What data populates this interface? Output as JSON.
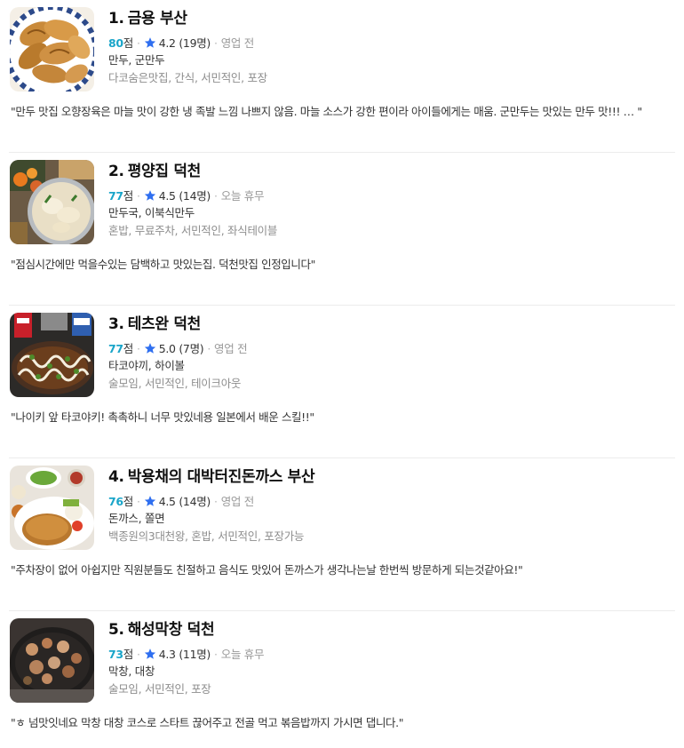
{
  "colors": {
    "score": "#1aa5c9",
    "star": "#2f6ff0",
    "muted": "#999999",
    "tags": "#8e8e8e"
  },
  "restaurants": [
    {
      "rank": "1.",
      "name": "금용 부산",
      "score": "80",
      "score_unit": "점",
      "rating": "4.2 (19명)",
      "status": "영업 전",
      "menu": "만두, 군만두",
      "tags": "다코숨은맛집, 간식, 서민적인, 포장",
      "review": "\"만두 맛집 오향장육은 마늘 맛이 강한 냉 족발 느낌 나쁘지 않음. 마늘 소스가 강한 편이라 아이들에게는 매움. 군만두는 맛있는 만두 맛!!! …   \"",
      "photo_icon": "dumpling-photo"
    },
    {
      "rank": "2.",
      "name": "평양집 덕천",
      "score": "77",
      "score_unit": "점",
      "rating": "4.5 (14명)",
      "status": "오늘 휴무",
      "menu": "만두국, 이북식만두",
      "tags": "혼밥, 무료주차, 서민적인, 좌식테이블",
      "review": "\"점심시간에만 먹을수있는 담백하고 맛있는집. 덕천맛집 인정입니다\"",
      "photo_icon": "dumpling-soup-photo"
    },
    {
      "rank": "3.",
      "name": "테츠완 덕천",
      "score": "77",
      "score_unit": "점",
      "rating": "5.0 (7명)",
      "status": "영업 전",
      "menu": "타코야끼, 하이볼",
      "tags": "술모임, 서민적인, 테이크아웃",
      "review": "\"나이키 앞 타코야키! 촉촉하니 너무 맛있네용 일본에서 배운 스킬!!\"",
      "photo_icon": "takoyaki-photo"
    },
    {
      "rank": "4.",
      "name": "박용채의 대박터진돈까스 부산",
      "score": "76",
      "score_unit": "점",
      "rating": "4.5 (14명)",
      "status": "영업 전",
      "menu": "돈까스, 쫄면",
      "tags": "백종원의3대천왕, 혼밥, 서민적인, 포장가능",
      "review": "\"주차장이 없어 아쉽지만 직원분들도 친절하고 음식도 맛있어 돈까스가 생각나는날 한번씩 방문하게 되는것같아요!\"",
      "photo_icon": "tonkatsu-photo"
    },
    {
      "rank": "5.",
      "name": "해성막창 덕천",
      "score": "73",
      "score_unit": "점",
      "rating": "4.3 (11명)",
      "status": "오늘 휴무",
      "menu": "막창, 대창",
      "tags": "술모임, 서민적인, 포장",
      "review": "\"ㅎ 넘맛잇네요 막창 대창 코스로 스타트 끊어주고 전골 먹고 볶음밥까지 가시면 댑니다.\"",
      "photo_icon": "grilled-makchang-photo"
    }
  ]
}
